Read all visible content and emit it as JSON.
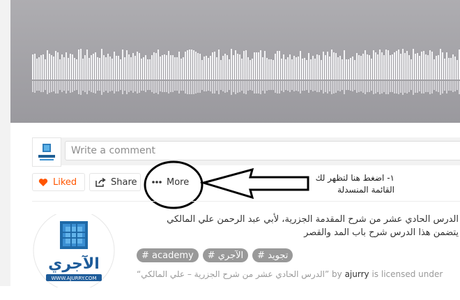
{
  "comment": {
    "placeholder": "Write a comment"
  },
  "actions": {
    "liked_label": "Liked",
    "share_label": "Share",
    "more_label": "More"
  },
  "annotation": {
    "line1": "١- اضغط هنا لتظهر لك",
    "line2": "القائمة المنسدلة"
  },
  "description": {
    "line1": "الدرس الحادي عشر من شرح المقدمة الجزرية، لأبي عبد الرحمن علي المالكي",
    "line2": "يتضمن هذا الدرس شرح باب المد والقصر"
  },
  "tags": [
    "# academy",
    "# الآجري",
    "# تجويد"
  ],
  "license": {
    "title": "“الدرس الحادي عشر من شرح الجزرية – علي المالكي”",
    "by": " by ",
    "user": "ajurry",
    "rest": " is licensed under"
  },
  "logo": {
    "text": "الآجري",
    "url": "WWW.AJURRY.COM"
  },
  "colors": {
    "accent": "#ff5500",
    "waveform_bg": "#a5a4a9",
    "tag_bg": "#999999"
  },
  "icons": [
    "heart-icon",
    "share-icon",
    "more-dots-icon",
    "arrow-icon"
  ]
}
